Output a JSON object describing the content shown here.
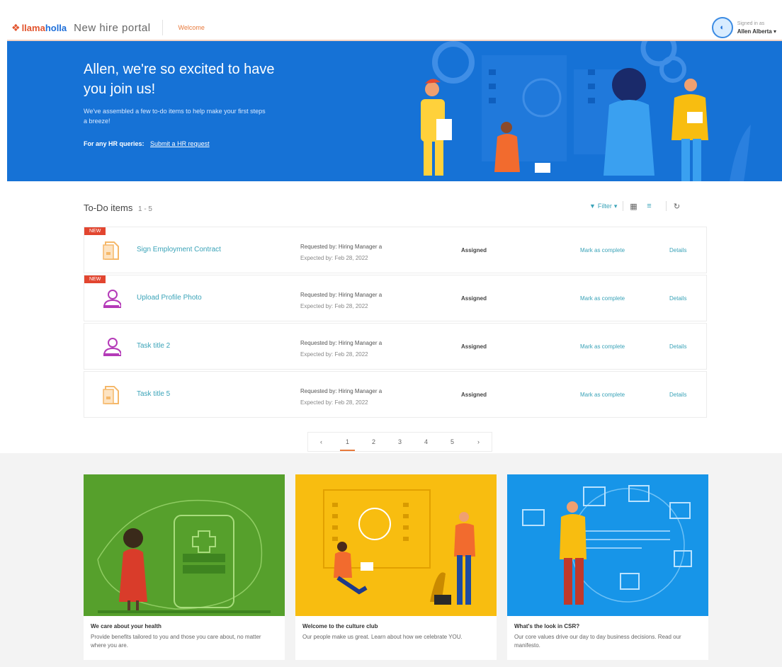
{
  "header": {
    "logo_word1": "llama",
    "logo_word2": "holla",
    "portal_title": "New hire portal",
    "tab_welcome": "Welcome",
    "user_caption": "Signed in as",
    "user_name": "Allen Alberta"
  },
  "hero": {
    "title": "Allen, we're so excited to have you join us!",
    "description": "We've assembled a few to-do items to help make your first steps a breeze!",
    "hr_label": "For any HR queries:",
    "hr_link": "Submit a HR request"
  },
  "todo": {
    "title": "To-Do items",
    "count": "1 - 5",
    "filter_label": "Filter",
    "items": [
      {
        "name": "Sign Employment Contract",
        "requested": "Requested by: Hiring Manager a",
        "expected": "Expected by: Feb 28, 2022",
        "status": "Assigned",
        "action": "Mark as complete",
        "details": "Details",
        "is_new": true,
        "new_label": "NEW",
        "icon": "document-icon"
      },
      {
        "name": "Upload Profile Photo",
        "requested": "Requested by: Hiring Manager a",
        "expected": "Expected by: Feb 28, 2022",
        "status": "Assigned",
        "action": "Mark as complete",
        "details": "Details",
        "is_new": true,
        "new_label": "NEW",
        "icon": "profile-photo-icon"
      },
      {
        "name": "Task title 2",
        "requested": "Requested by: Hiring Manager a",
        "expected": "Expected by: Feb 28, 2022",
        "status": "Assigned",
        "action": "Mark as complete",
        "details": "Details",
        "is_new": false,
        "new_label": "",
        "icon": "profile-photo-icon"
      },
      {
        "name": "Task title 5",
        "requested": "Requested by: Hiring Manager a",
        "expected": "Expected by: Feb 28, 2022",
        "status": "Assigned",
        "action": "Mark as complete",
        "details": "Details",
        "is_new": false,
        "new_label": "",
        "icon": "document-icon"
      }
    ]
  },
  "pagination": {
    "prev": "‹",
    "pages": [
      "1",
      "2",
      "3",
      "4",
      "5"
    ],
    "next": "›",
    "current": "1"
  },
  "cards": [
    {
      "title": "We care about your health",
      "description": "Provide benefits tailored to you and those you care about, no matter where you are.",
      "bg": "#56a02c"
    },
    {
      "title": "Welcome to the culture club",
      "description": "Our people make us great. Learn about how we celebrate YOU.",
      "bg": "#f8bd10"
    },
    {
      "title": "What's the look in CSR?",
      "description": "Our core values drive our day to day business decisions. Read our manifesto.",
      "bg": "#1795e8"
    }
  ],
  "colors": {
    "brand_orange": "#e2552f",
    "brand_blue": "#1e6fd9",
    "hero_blue": "#1672d6",
    "accent_teal": "#3aa3b8",
    "new_badge": "#e2452f"
  }
}
